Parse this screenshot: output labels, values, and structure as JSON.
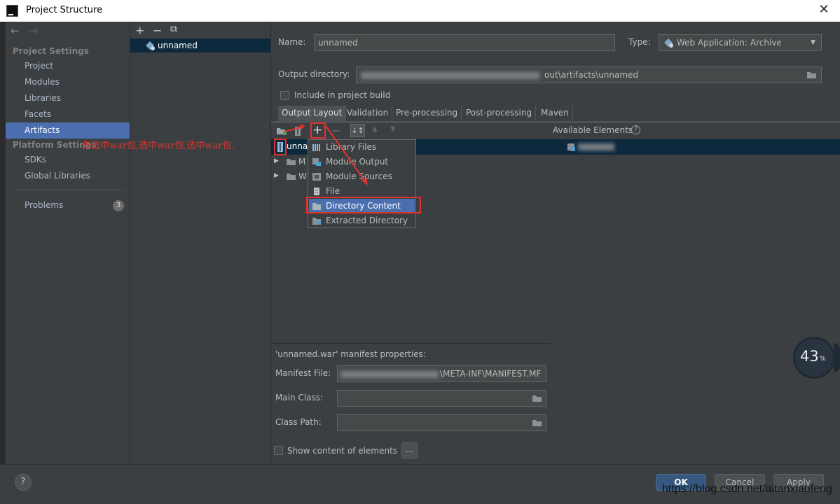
{
  "window": {
    "title": "Project Structure",
    "close_label": "✕"
  },
  "nav": {
    "back": "←",
    "forward": "→"
  },
  "sidebar": {
    "project_settings_title": "Project Settings",
    "project_items": [
      {
        "label": "Project"
      },
      {
        "label": "Modules"
      },
      {
        "label": "Libraries"
      },
      {
        "label": "Facets"
      },
      {
        "label": "Artifacts"
      }
    ],
    "platform_settings_title": "Platform Settings",
    "platform_items": [
      {
        "label": "SDKs"
      },
      {
        "label": "Global Libraries"
      }
    ],
    "problems": {
      "label": "Problems",
      "count": "3"
    }
  },
  "artifacts_panel": {
    "add": "+",
    "remove": "−",
    "copy": "⧉",
    "items": [
      {
        "label": "unnamed"
      }
    ]
  },
  "artifact": {
    "name_label": "Name:",
    "name_value": "unnamed",
    "type_label": "Type:",
    "type_value": "Web Application: Archive",
    "output_label": "Output directory:",
    "output_value": "out\\artifacts\\unnamed",
    "include_build_label": "Include in project build"
  },
  "tabs": [
    {
      "label": "Output Layout"
    },
    {
      "label": "Validation"
    },
    {
      "label": "Pre-processing"
    },
    {
      "label": "Post-processing"
    },
    {
      "label": "Maven"
    }
  ],
  "layout": {
    "available_elements_label": "Available Elements",
    "tree": [
      {
        "label": "unnamed"
      },
      {
        "label": "M"
      },
      {
        "label": "W"
      }
    ]
  },
  "popup_menu": {
    "items": [
      {
        "label": "Library Files"
      },
      {
        "label": "Module Output"
      },
      {
        "label": "Module Sources"
      },
      {
        "label": "File"
      },
      {
        "label": "Directory Content"
      },
      {
        "label": "Extracted Directory"
      }
    ]
  },
  "annotation": {
    "text": "先选中war包,选中war包,选中war包."
  },
  "manifest": {
    "title": "'unnamed.war' manifest properties:",
    "file_label": "Manifest File:",
    "file_value": "\\META-INF\\MANIFEST.MF",
    "main_class_label": "Main Class:",
    "class_path_label": "Class Path:",
    "show_content_label": "Show content of elements",
    "more_button": "..."
  },
  "buttons": {
    "ok": "OK",
    "cancel": "Cancel",
    "apply": "Apply",
    "help": "?"
  },
  "gauge": {
    "value": "43",
    "unit": "%"
  },
  "watermark": {
    "text": "https://blog.csdn.net/aitanxiaofeng"
  },
  "colors": {
    "accent": "#4b6eaf",
    "annotation_red": "#e0322b",
    "background": "#3c3f41"
  }
}
